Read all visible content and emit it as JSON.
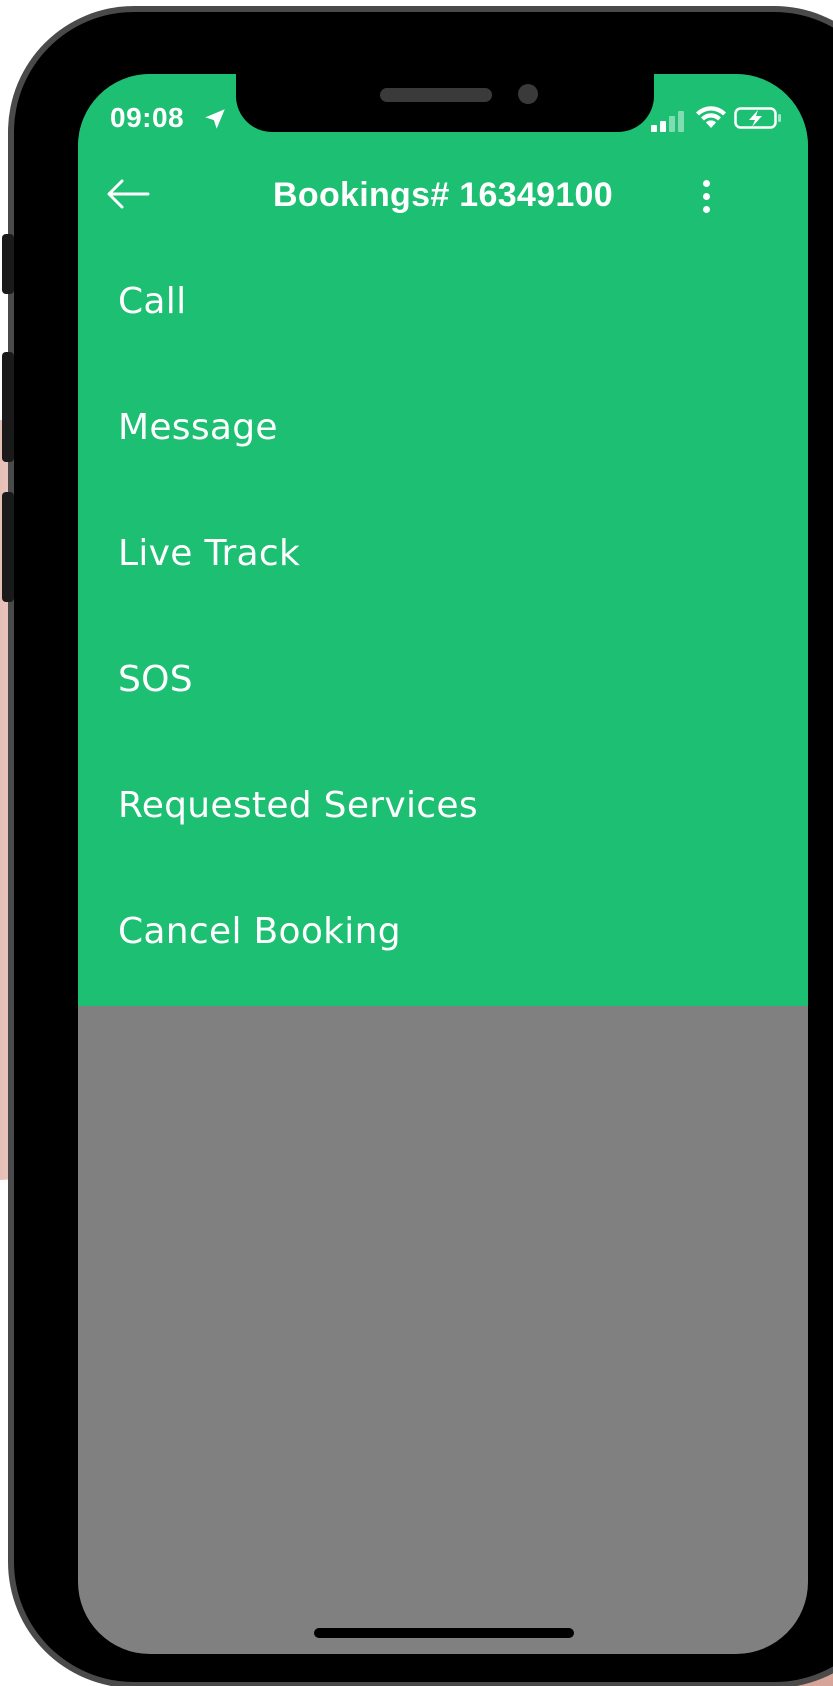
{
  "status_bar": {
    "time": "09:08",
    "location_icon": "location-arrow-icon",
    "signal_icon": "cellular-signal-icon",
    "wifi_icon": "wifi-icon",
    "battery_icon": "battery-charging-icon"
  },
  "header": {
    "back_icon": "arrow-left-icon",
    "title": "Bookings# 16349100",
    "more_icon": "more-vertical-icon"
  },
  "menu": {
    "items": [
      {
        "label": "Call"
      },
      {
        "label": "Message"
      },
      {
        "label": "Live Track"
      },
      {
        "label": "SOS"
      },
      {
        "label": "Requested Services"
      },
      {
        "label": "Cancel Booking"
      }
    ]
  },
  "colors": {
    "primary": "#1dbf73",
    "overlay": "#808080",
    "text": "#ffffff"
  }
}
